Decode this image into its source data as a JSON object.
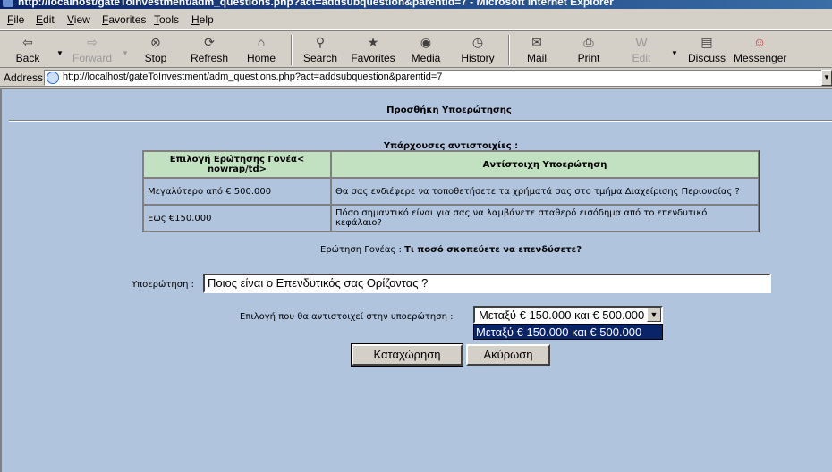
{
  "window": {
    "title": "http://localhost/gateToInvestment/adm_questions.php?act=addsubquestion&parentid=7 - Microsoft Internet Explorer"
  },
  "menu": [
    "File",
    "Edit",
    "View",
    "Favorites",
    "Tools",
    "Help"
  ],
  "toolbar": {
    "back": "Back",
    "forward": "Forward",
    "stop": "Stop",
    "refresh": "Refresh",
    "home": "Home",
    "search": "Search",
    "favorites": "Favorites",
    "media": "Media",
    "history": "History",
    "mail": "Mail",
    "print": "Print",
    "edit": "Edit",
    "discuss": "Discuss",
    "messenger": "Messenger"
  },
  "address": {
    "label": "Address",
    "url": "http://localhost/gateToInvestment/adm_questions.php?act=addsubquestion&parentid=7"
  },
  "page": {
    "title": "Προσθήκη Υποερώτησης",
    "existing_title": "Υπάρχουσες αντιστοιχίες :",
    "table": {
      "headers": [
        "Επιλογή Ερώτησης Γονέα< nowrap/td>",
        "Αντίστοιχη Υποερώτηση"
      ],
      "rows": [
        [
          "Μεγαλύτερο από € 500.000",
          "Θα σας ενδιέφερε να τοποθετήσετε τα χρήματά σας στο τμήμα Διαχείρισης Περιουσίας ?"
        ],
        [
          "Εως €150.000",
          "Πόσο σημαντικό είναι για σας να λαμβάνετε σταθερό εισόδημα από το επενδυτικό κεφάλαιο?"
        ]
      ]
    },
    "parent_label": "Ερώτηση Γονέας :",
    "parent_question": "Τι ποσό σκοπεύετε να επενδύσετε?",
    "subquestion_label": "Υποερώτηση :",
    "subquestion_value": "Ποιος είναι ο Επενδυτικός σας Ορίζοντας ?",
    "option_label": "Επιλογή που θα αντιστοιχεί στην υποερώτηση :",
    "option_selected": "Μεταξύ € 150.000 και € 500.000",
    "option_highlighted": "Μεταξύ € 150.000 και € 500.000",
    "submit_label": "Καταχώρηση",
    "cancel_label": "Ακύρωση"
  }
}
